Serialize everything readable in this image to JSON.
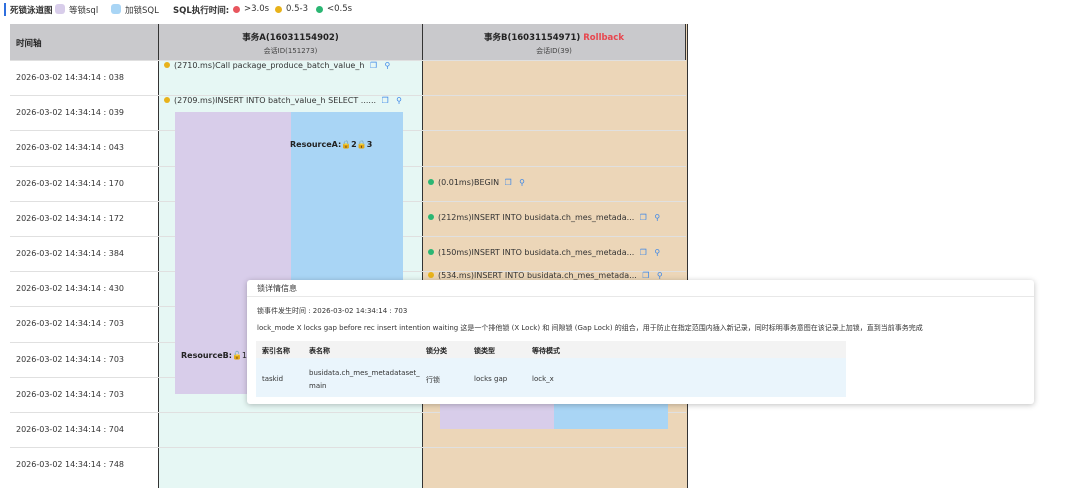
{
  "legend": {
    "title": "死锁泳道图",
    "wait_label": "等锁sql",
    "lock_label": "加锁SQL",
    "exec_time_label": "SQL执行时间:",
    "thresholds": [
      {
        "label": ">3.0s",
        "color": "#e8565e"
      },
      {
        "label": "0.5-3",
        "color": "#e8b21a"
      },
      {
        "label": "<0.5s",
        "color": "#2bb673"
      }
    ],
    "wait_color": "#d8cdea",
    "lock_color": "#a9d5f5"
  },
  "header": {
    "time_axis": "时间轴",
    "tx_a": {
      "title": "事务A(16031154902)",
      "session": "会话ID(151273)"
    },
    "tx_b": {
      "title": "事务B(16031154971)",
      "rollback": "Rollback",
      "session": "会话ID(39)"
    }
  },
  "times": [
    "2026-03-02 14:34:14 : 038",
    "2026-03-02 14:34:14 : 039",
    "2026-03-02 14:34:14 : 043",
    "2026-03-02 14:34:14 : 170",
    "2026-03-02 14:34:14 : 172",
    "2026-03-02 14:34:14 : 384",
    "2026-03-02 14:34:14 : 430",
    "2026-03-02 14:34:14 : 703",
    "2026-03-02 14:34:14 : 703",
    "2026-03-02 14:34:14 : 703",
    "2026-03-02 14:34:14 : 704",
    "2026-03-02 14:34:14 : 748"
  ],
  "sql_a": [
    {
      "text": "(2710.ms)Call package_produce_batch_value_h",
      "color": "#e8b21a"
    },
    {
      "text": "(2709.ms)INSERT INTO batch_value_h SELECT ......",
      "color": "#e8b21a"
    }
  ],
  "sql_b": [
    {
      "text": "(0.01ms)BEGIN",
      "color": "#2bb673"
    },
    {
      "text": "(212ms)INSERT INTO busidata.ch_mes_metada...",
      "color": "#2bb673"
    },
    {
      "text": "(150ms)INSERT INTO busidata.ch_mes_metada...",
      "color": "#2bb673"
    },
    {
      "text": "(534.ms)INSERT INTO busidata.ch_mes_metada...",
      "color": "#e8b21a"
    }
  ],
  "resources": {
    "a_label": "ResourceA:",
    "a_suffix": "2",
    "a_suffix2": "3",
    "b_label": "ResourceB:",
    "b_suffix": "1"
  },
  "popup": {
    "title": "锁详情信息",
    "time_line": "锁事件发生时间 : 2026-03-02 14:34:14 : 703",
    "description": "lock_mode X locks gap before rec insert intention waiting 这是一个排他锁 (X Lock) 和 间隙锁 (Gap Lock) 的组合，用于防止在指定范围内插入新记录，同时标明事务意图在该记录上加锁，直到当前事务完成",
    "columns": [
      "索引名称",
      "表名称",
      "锁分类",
      "锁类型",
      "等待模式"
    ],
    "row": [
      "taskid",
      "busidata.ch_mes_metadataset_main",
      "行锁",
      "locks gap",
      "lock_x"
    ]
  }
}
